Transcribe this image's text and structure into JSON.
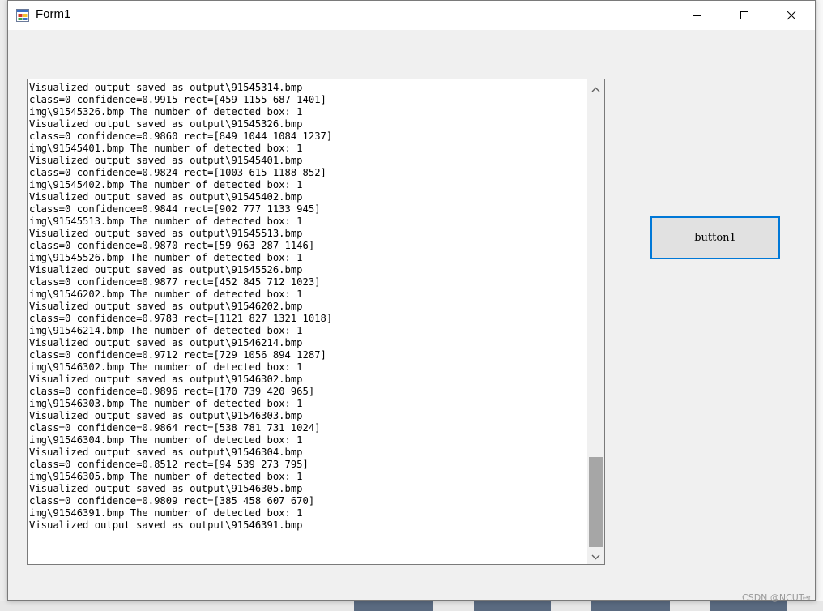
{
  "window": {
    "title": "Form1"
  },
  "titlebar_buttons": {
    "minimize_icon": "minimize-icon",
    "maximize_icon": "maximize-icon",
    "close_icon": "close-icon"
  },
  "textbox": {
    "lines": [
      "Visualized output saved as output\\91545314.bmp",
      "class=0 confidence=0.9915 rect=[459 1155 687 1401]",
      "img\\91545326.bmp The number of detected box: 1",
      "Visualized output saved as output\\91545326.bmp",
      "class=0 confidence=0.9860 rect=[849 1044 1084 1237]",
      "img\\91545401.bmp The number of detected box: 1",
      "Visualized output saved as output\\91545401.bmp",
      "class=0 confidence=0.9824 rect=[1003 615 1188 852]",
      "img\\91545402.bmp The number of detected box: 1",
      "Visualized output saved as output\\91545402.bmp",
      "class=0 confidence=0.9844 rect=[902 777 1133 945]",
      "img\\91545513.bmp The number of detected box: 1",
      "Visualized output saved as output\\91545513.bmp",
      "class=0 confidence=0.9870 rect=[59 963 287 1146]",
      "img\\91545526.bmp The number of detected box: 1",
      "Visualized output saved as output\\91545526.bmp",
      "class=0 confidence=0.9877 rect=[452 845 712 1023]",
      "img\\91546202.bmp The number of detected box: 1",
      "Visualized output saved as output\\91546202.bmp",
      "class=0 confidence=0.9783 rect=[1121 827 1321 1018]",
      "img\\91546214.bmp The number of detected box: 1",
      "Visualized output saved as output\\91546214.bmp",
      "class=0 confidence=0.9712 rect=[729 1056 894 1287]",
      "img\\91546302.bmp The number of detected box: 1",
      "Visualized output saved as output\\91546302.bmp",
      "class=0 confidence=0.9896 rect=[170 739 420 965]",
      "img\\91546303.bmp The number of detected box: 1",
      "Visualized output saved as output\\91546303.bmp",
      "class=0 confidence=0.9864 rect=[538 781 731 1024]",
      "img\\91546304.bmp The number of detected box: 1",
      "Visualized output saved as output\\91546304.bmp",
      "class=0 confidence=0.8512 rect=[94 539 273 795]",
      "img\\91546305.bmp The number of detected box: 1",
      "Visualized output saved as output\\91546305.bmp",
      "class=0 confidence=0.9809 rect=[385 458 607 670]",
      "img\\91546391.bmp The number of detected box: 1",
      "Visualized output saved as output\\91546391.bmp"
    ],
    "scroll_position": 1.0,
    "scroll_visible_fraction": 0.2
  },
  "button1": {
    "label": "button1"
  },
  "watermark": "CSDN @NCUTer",
  "colors": {
    "focus_border": "#0078d7",
    "window_bg": "#f0f0f0",
    "scroll_thumb": "#a6a6a6"
  }
}
